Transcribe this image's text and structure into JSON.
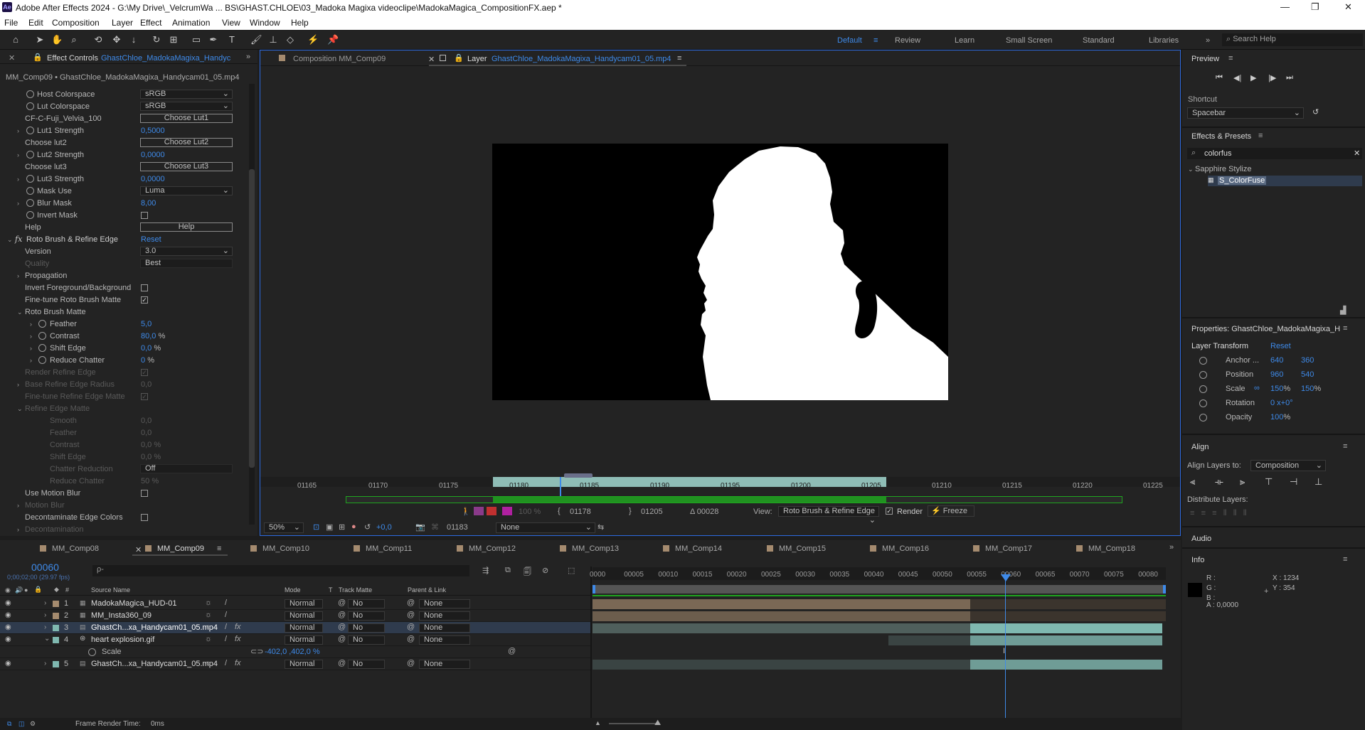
{
  "window": {
    "title": "Adobe After Effects 2024 - G:\\My Drive\\_VelcrumWa ... BS\\GHAST.CHLOE\\03_Madoka Magixa videoclipe\\MadokaMagica_CompositionFX.aep *",
    "ae_badge": "Ae",
    "min": "—",
    "max": "❐",
    "close": "✕"
  },
  "menu": [
    "File",
    "Edit",
    "Composition",
    "Layer",
    "Effect",
    "Animation",
    "View",
    "Window",
    "Help"
  ],
  "workspaces": [
    "Default",
    "Review",
    "Learn",
    "Small Screen",
    "Standard",
    "Libraries"
  ],
  "search_help": "Search Help",
  "effect_controls": {
    "tab_label": "Effect Controls",
    "tab_layer": "GhastChloe_MadokaMagixa_Handyc",
    "path": "MM_Comp09 • GhastChloe_MadokaMagixa_Handycam01_05.mp4",
    "host_colorspace_label": "Host Colorspace",
    "host_colorspace": "sRGB",
    "lut_colorspace_label": "Lut Colorspace",
    "lut_colorspace": "sRGB",
    "lut1_name": "CF-C-Fuji_Velvia_100",
    "choose_lut1": "Choose Lut1",
    "lut1_strength_label": "Lut1 Strength",
    "lut1_strength": "0,5000",
    "choose_lut2_label": "Choose lut2",
    "choose_lut2": "Choose Lut2",
    "lut2_strength_label": "Lut2 Strength",
    "lut2_strength": "0,0000",
    "choose_lut3_label": "Choose lut3",
    "choose_lut3": "Choose Lut3",
    "lut3_strength_label": "Lut3 Strength",
    "lut3_strength": "0,0000",
    "mask_use_label": "Mask Use",
    "mask_use": "Luma",
    "blur_mask_label": "Blur Mask",
    "blur_mask": "8,00",
    "invert_mask_label": "Invert Mask",
    "help_label": "Help",
    "help_button": "Help",
    "fx_name": "Roto Brush & Refine Edge",
    "reset": "Reset",
    "version_label": "Version",
    "version": "3.0",
    "quality_label": "Quality",
    "quality": "Best",
    "propagation": "Propagation",
    "invert_fg_bg": "Invert Foreground/Background",
    "finetune_roto": "Fine-tune Roto Brush Matte",
    "roto_brush_matte": "Roto Brush Matte",
    "feather_label": "Feather",
    "feather": "5,0",
    "contrast_label": "Contrast",
    "contrast": "80,0",
    "shift_edge_label": "Shift Edge",
    "shift_edge": "0,0",
    "reduce_chatter_label": "Reduce Chatter",
    "reduce_chatter": "0",
    "percent": "%",
    "render_refine_edge": "Render Refine Edge",
    "base_refine_radius_label": "Base Refine Edge Radius",
    "base_refine_radius": "0,0",
    "finetune_refine": "Fine-tune Refine Edge Matte",
    "refine_edge_matte": "Refine Edge Matte",
    "smooth_label": "Smooth",
    "smooth": "0,0",
    "feather2": "0,0",
    "contrast2": "0,0",
    "shift_edge2": "0,0",
    "chatter_reduction_label": "Chatter Reduction",
    "chatter_reduction": "Off",
    "reduce_chatter2": "50",
    "use_motion_blur": "Use Motion Blur",
    "motion_blur": "Motion Blur",
    "decontaminate": "Decontaminate Edge Colors",
    "decontamination": "Decontamination"
  },
  "viewer": {
    "comp_tab": "Composition MM_Comp09",
    "layer_tab_prefix": "Layer",
    "layer_tab_name": "GhastChloe_MadokaMagixa_Handycam01_05.mp4",
    "ruler_ticks": [
      "01165",
      "01170",
      "01175",
      "01180",
      "01185",
      "01190",
      "01195",
      "01200",
      "01205",
      "01210",
      "01215",
      "01220",
      "01225"
    ],
    "zoom": "50%",
    "exposure": "+0,0",
    "current_frame": "01183",
    "channel_none": "None",
    "in_point": "01178",
    "out_point": "01205",
    "duration": "Δ 00028",
    "view_label": "View:",
    "view_value": "Roto Brush & Refine Edge",
    "render_label": "Render",
    "freeze_label": "Freeze",
    "pct100": "100 %"
  },
  "timeline": {
    "tabs": [
      "MM_Comp08",
      "MM_Comp09",
      "MM_Comp10",
      "MM_Comp11",
      "MM_Comp12",
      "MM_Comp13",
      "MM_Comp14",
      "MM_Comp15",
      "MM_Comp16",
      "MM_Comp17",
      "MM_Comp18"
    ],
    "timecode": "00060",
    "timecode_sub": "0;00;02;00 (29.97 fps)",
    "search_placeholder": "ρ-",
    "col_num": "#",
    "col_source": "Source Name",
    "col_mode": "Mode",
    "col_t": "T",
    "col_track": "Track Matte",
    "col_parent": "Parent & Link",
    "layers": [
      {
        "num": "1",
        "name": "MadokaMagica_HUD-01",
        "mode": "Normal",
        "matte": "No Matte",
        "parent": "None",
        "color": "#a58b6f"
      },
      {
        "num": "2",
        "name": "MM_Insta360_09",
        "mode": "Normal",
        "matte": "No Matte",
        "parent": "None",
        "color": "#a58b6f"
      },
      {
        "num": "3",
        "name": "GhastCh...xa_Handycam01_05.mp4",
        "mode": "Normal",
        "matte": "No Matte",
        "parent": "None",
        "color": "#7fb8b0"
      },
      {
        "num": "4",
        "name": "heart explosion.gif",
        "mode": "Normal",
        "matte": "No Matte",
        "parent": "None",
        "color": "#7fb8b0"
      },
      {
        "num": "5",
        "name": "GhastCh...xa_Handycam01_05.mp4",
        "mode": "Normal",
        "matte": "No Matte",
        "parent": "None",
        "color": "#7fb8b0"
      }
    ],
    "scale_label": "Scale",
    "scale_value": "-402,0 ,402,0 %",
    "ruler": [
      "0000",
      "00005",
      "00010",
      "00015",
      "00020",
      "00025",
      "00030",
      "00035",
      "00040",
      "00045",
      "00050",
      "00055",
      "00060",
      "00065",
      "00070",
      "00075",
      "00080"
    ],
    "frame_render_time_label": "Frame Render Time:",
    "frame_render_time": "0ms"
  },
  "preview": {
    "title": "Preview",
    "shortcut_label": "Shortcut",
    "shortcut": "Spacebar"
  },
  "effects_presets": {
    "title": "Effects & Presets",
    "search": "colorfus",
    "category": "Sapphire Stylize",
    "item": "S_ColorFuse"
  },
  "properties": {
    "title": "Properties: GhastChloe_MadokaMagixa_H",
    "section": "Layer Transform",
    "reset": "Reset",
    "anchor_label": "Anchor ...",
    "anchor_x": "640",
    "anchor_y": "360",
    "position_label": "Position",
    "position_x": "960",
    "position_y": "540",
    "scale_label": "Scale",
    "scale_x": "150",
    "scale_y": "150",
    "rotation_label": "Rotation",
    "rotation": "0 x+0°",
    "opacity_label": "Opacity",
    "opacity": "100",
    "pct": "%"
  },
  "align": {
    "title": "Align",
    "align_to_label": "Align Layers to:",
    "align_to": "Composition",
    "distribute": "Distribute Layers:"
  },
  "audio": {
    "title": "Audio"
  },
  "info": {
    "title": "Info",
    "r": "R :",
    "g": "G :",
    "b": "B :",
    "a": "A : 0,0000",
    "x": "X : 1234",
    "y": "Y : 354"
  },
  "colors": {
    "accent": "#3e8ae9",
    "panel": "#232323",
    "viewer_border": "#2d6ae0",
    "roto_bar": "#1fa51f"
  }
}
